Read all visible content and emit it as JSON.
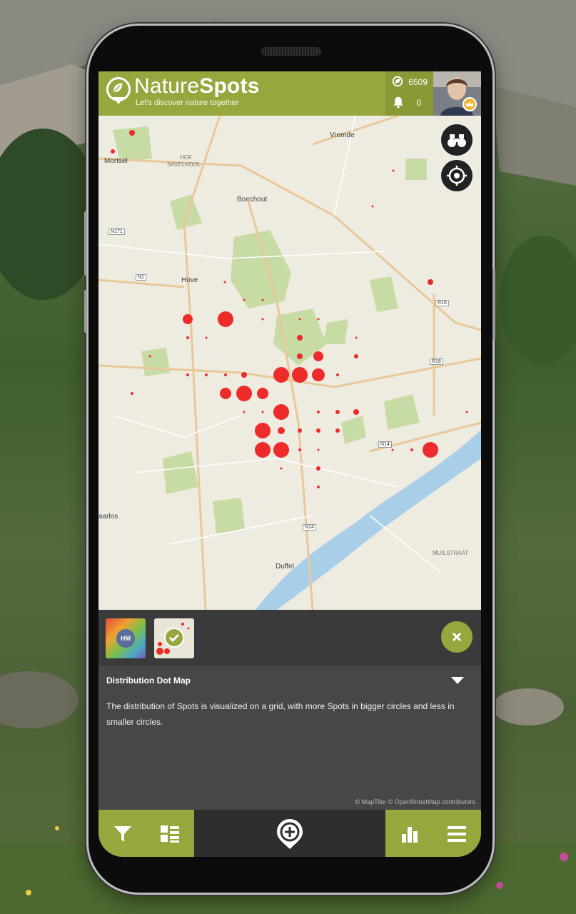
{
  "header": {
    "brand_light": "Nature",
    "brand_bold": "Spots",
    "tagline": "Let's discover nature together",
    "spots_count": "6509",
    "notifications_count": "0"
  },
  "map": {
    "places": [
      "Vremde",
      "Mortsel",
      "HOF",
      "SAVELKOOL",
      "Boechout",
      "Hove",
      "Duffel",
      "MUILSTRAAT",
      "aarlos"
    ],
    "roads": [
      "N171",
      "N1",
      "R16",
      "R16",
      "N14",
      "N14"
    ]
  },
  "panel": {
    "thumb_heatmap_label": "HM",
    "title": "Distribution Dot Map",
    "description": "The distribution of Spots is visualized on a grid, with more Spots in bigger circles and less in smaller circles.",
    "attribution": "© MapTiler © OpenStreetMap contributors"
  },
  "icons": {
    "binoculars": "binoculars-icon",
    "locate": "crosshair-icon",
    "close": "close-icon",
    "filter": "filter-icon",
    "list": "list-view-icon",
    "add": "add-spot-icon",
    "stats": "bar-chart-icon",
    "menu": "hamburger-menu-icon"
  },
  "colors": {
    "brand_green": "#98a63e",
    "dot_red": "#ee2b2b",
    "panel_dark": "#3a3a3a"
  }
}
